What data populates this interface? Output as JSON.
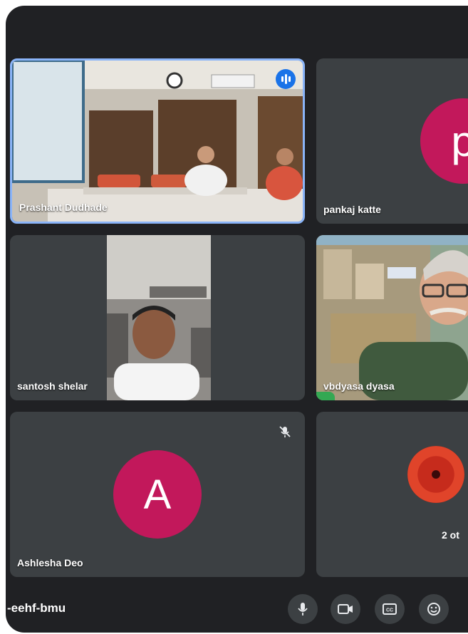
{
  "participants": [
    {
      "name": "Prashant Dudhade",
      "speaking": true
    },
    {
      "name": "pankaj katte",
      "avatar_letter": "p"
    },
    {
      "name": "santosh shelar"
    },
    {
      "name": "vbdyasa dyasa"
    },
    {
      "name": "Ashlesha Deo",
      "avatar_letter": "A",
      "muted": true
    },
    {
      "others_label": "2 ot"
    }
  ],
  "meeting": {
    "code": "-eehf-bmu"
  },
  "controls": [
    "mic-icon",
    "camera-icon",
    "captions-icon",
    "emoji-icon"
  ],
  "colors": {
    "background": "#202124",
    "tile": "#3c4043",
    "avatar": "#c2185b",
    "active_speaker": "#1a73e8"
  }
}
